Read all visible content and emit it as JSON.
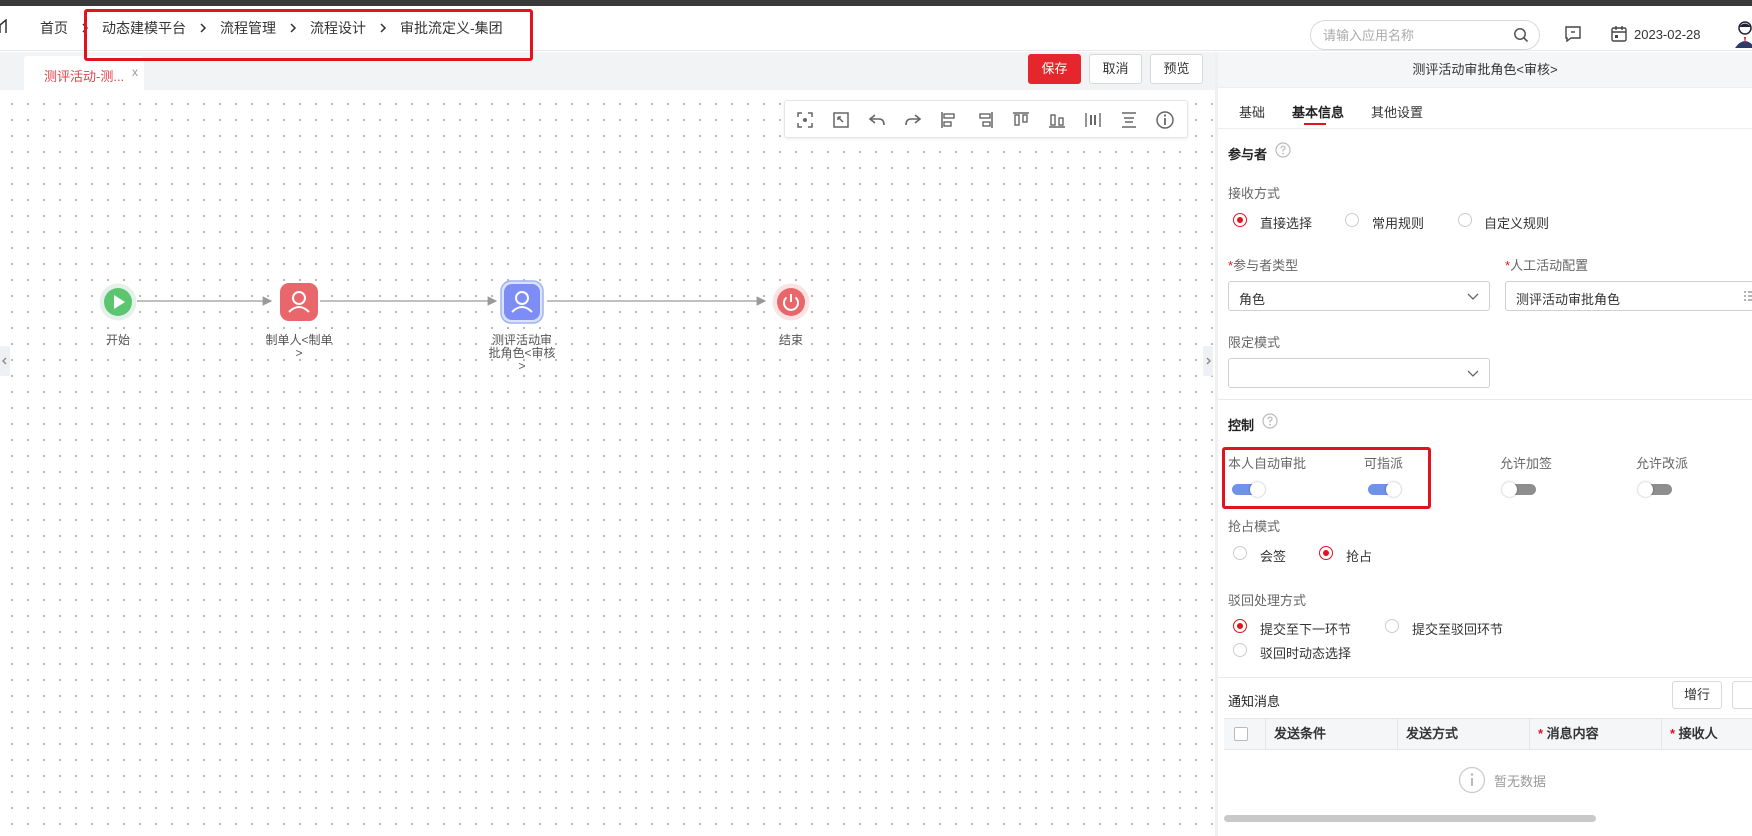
{
  "header": {
    "breadcrumbs": [
      "首页",
      "动态建模平台",
      "流程管理",
      "流程设计",
      "审批流定义-集团"
    ],
    "search_placeholder": "请输入应用名称",
    "date": "2023-02-28"
  },
  "tab": {
    "label": "测评活动-测...",
    "close": "x"
  },
  "actions": {
    "save": "保存",
    "cancel": "取消",
    "preview": "预览"
  },
  "toolbar_tools": [
    "fit-screen-icon",
    "actual-size-icon",
    "undo-icon",
    "redo-icon",
    "align-left-icon",
    "align-right-icon",
    "align-top-icon",
    "align-bottom-icon",
    "distribute-horizontal-icon",
    "distribute-vertical-icon",
    "info-icon"
  ],
  "flow": {
    "nodes": [
      {
        "label": "开始",
        "type": "start",
        "color": "#5cc56f"
      },
      {
        "label": "制单人<制单>",
        "line1": "制单人<制单",
        "line2": ">",
        "type": "user",
        "color": "#e9666a"
      },
      {
        "label": "测评活动审批角色<审核>",
        "line1": "测评活动审",
        "line2": "批角色<审核",
        "line3": ">",
        "type": "user-selected",
        "color": "#7e8df5"
      },
      {
        "label": "结束",
        "type": "end",
        "color": "#e9666a"
      }
    ]
  },
  "panel": {
    "title": "测评活动审批角色<审核>",
    "tabs": [
      "基础",
      "基本信息",
      "其他设置"
    ],
    "active_tab": "基本信息",
    "participants": {
      "title": "参与者",
      "receive_mode_label": "接收方式",
      "receive_modes": [
        "直接选择",
        "常用规则",
        "自定义规则"
      ],
      "receive_mode_selected": "直接选择",
      "participant_type_label": "参与者类型",
      "participant_type_value": "角色",
      "manual_activity_label": "人工活动配置",
      "manual_activity_value": "测评活动审批角色",
      "limit_mode_label": "限定模式",
      "limit_mode_value": ""
    },
    "control": {
      "title": "控制",
      "toggles": [
        {
          "label": "本人自动审批",
          "on": true
        },
        {
          "label": "可指派",
          "on": true
        },
        {
          "label": "允许加签",
          "on": false
        },
        {
          "label": "允许改派",
          "on": false
        }
      ],
      "grab_mode_label": "抢占模式",
      "grab_modes": [
        "会签",
        "抢占"
      ],
      "grab_mode_selected": "抢占",
      "reject_label": "驳回处理方式",
      "reject_options": [
        "提交至下一环节",
        "提交至驳回环节",
        "驳回时动态选择"
      ],
      "reject_selected": "提交至下一环节"
    },
    "notify": {
      "title": "通知消息",
      "add_row": "增行",
      "columns": [
        "发送条件",
        "发送方式",
        "消息内容",
        "接收人"
      ],
      "required_columns": [
        "消息内容",
        "接收人"
      ],
      "empty_text": "暂无数据"
    }
  },
  "colors": {
    "accent": "#e5262d",
    "toggle_on": "#6f93e8",
    "highlight_box": "#e0141e"
  }
}
